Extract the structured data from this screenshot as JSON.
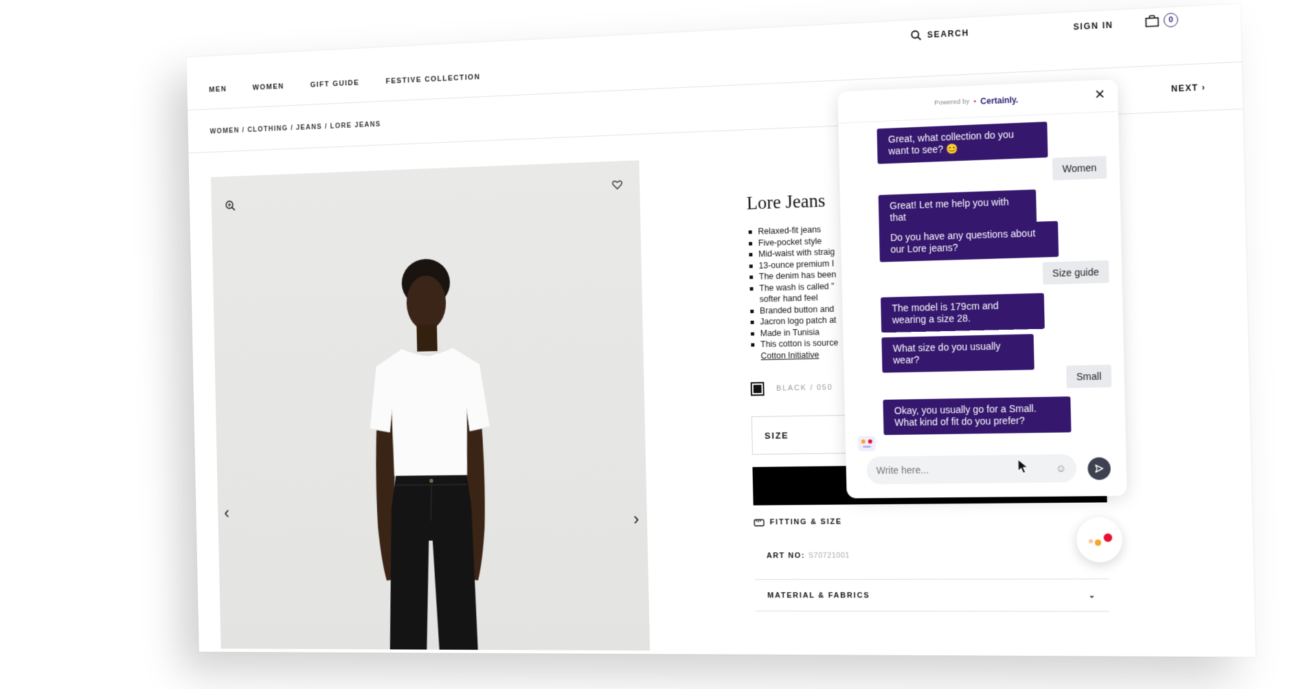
{
  "nav": {
    "items": [
      "MEN",
      "WOMEN",
      "GIFT GUIDE",
      "FESTIVE COLLECTION"
    ]
  },
  "header": {
    "search_label": "SEARCH",
    "signin_label": "SIGN IN",
    "bag_count": "0"
  },
  "breadcrumb": {
    "items": [
      "WOMEN",
      "CLOTHING",
      "JEANS",
      "LORE JEANS"
    ],
    "separator": " / ",
    "next_label": "NEXT"
  },
  "product": {
    "title": "Lore Jeans",
    "features": [
      "Relaxed-fit jeans",
      "Five-pocket style",
      "Mid-waist with straig",
      "13-ounce premium I",
      "The denim has been",
      "The wash is called \"",
      "softer hand feel",
      "Branded button and",
      "Jacron logo patch at",
      "Made in Tunisia",
      "This cotton is source"
    ],
    "cotton_link": "Cotton Initiative",
    "color_label": "BLACK / 050",
    "size_label": "SIZE",
    "fitting_label": "FITTING & SIZE",
    "art_no_label": "ART NO:",
    "art_no_value": "S70721001",
    "material_label": "MATERIAL & FABRICS"
  },
  "chat": {
    "powered_by": "Powered by",
    "brand": "Certainly.",
    "messages": [
      {
        "from": "bot",
        "text": "Great, what collection do you want to see? 😊"
      },
      {
        "from": "user",
        "text": "Women"
      },
      {
        "from": "bot",
        "text": "Great! Let me help you with that"
      },
      {
        "from": "bot",
        "text": "Do you have any questions about our Lore jeans?"
      },
      {
        "from": "user",
        "text": "Size guide"
      },
      {
        "from": "bot",
        "text": "The model is 179cm and wearing a size 28."
      },
      {
        "from": "bot",
        "text": "What size do you usually wear?"
      },
      {
        "from": "user",
        "text": "Small"
      },
      {
        "from": "bot",
        "text": "Okay, you usually go for a Small. What kind of fit do you prefer?"
      }
    ],
    "input_placeholder": "Write here..."
  },
  "colors": {
    "chat_bubble": "#35186e",
    "brand": "#2b1b74",
    "launcher_red": "#e8102f",
    "launcher_orange": "#f5a623"
  }
}
